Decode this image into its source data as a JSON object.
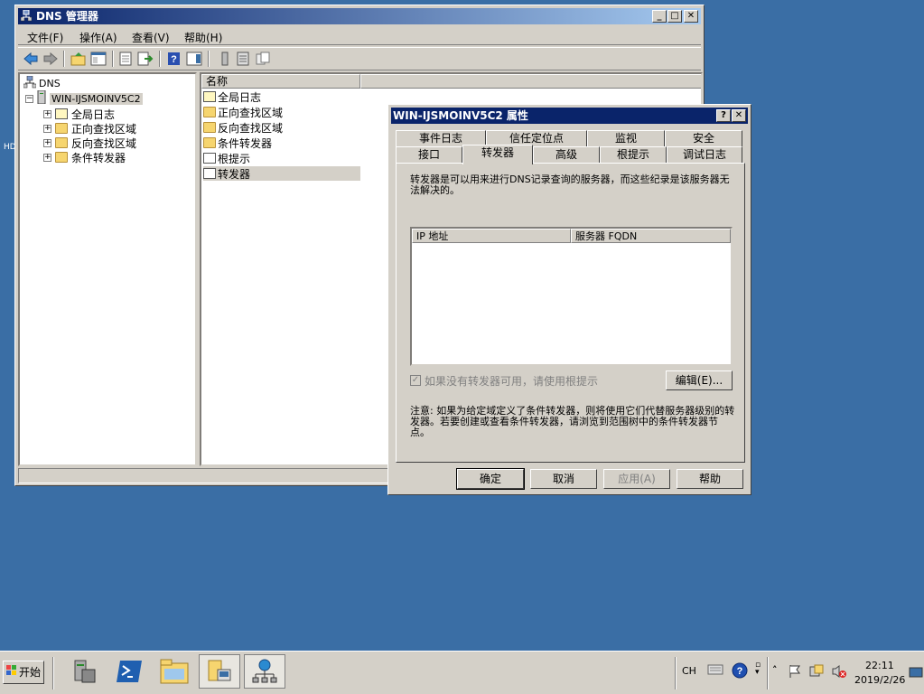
{
  "desktop": {
    "edge_label": "HD"
  },
  "main_window": {
    "title": "DNS 管理器",
    "menu": [
      "文件(F)",
      "操作(A)",
      "查看(V)",
      "帮助(H)"
    ],
    "tree": {
      "root": "DNS",
      "server": "WIN-IJSMOINV5C2",
      "children": [
        "全局日志",
        "正向查找区域",
        "反向查找区域",
        "条件转发器"
      ]
    },
    "list": {
      "column": "名称",
      "items": [
        "全局日志",
        "正向查找区域",
        "反向查找区域",
        "条件转发器",
        "根提示",
        "转发器"
      ]
    }
  },
  "dialog": {
    "title": "WIN-IJSMOINV5C2 属性",
    "tabs_row1": [
      "事件日志",
      "信任定位点",
      "监视",
      "安全"
    ],
    "tabs_row2": [
      "接口",
      "转发器",
      "高级",
      "根提示",
      "调试日志"
    ],
    "active_tab": "转发器",
    "description": "转发器是可以用来进行DNS记录查询的服务器，而这些纪录是该服务器无法解决的。",
    "table_headers": [
      "IP 地址",
      "服务器 FQDN"
    ],
    "checkbox_label": "如果没有转发器可用，请使用根提示",
    "edit_button": "编辑(E)...",
    "note": "注意: 如果为给定域定义了条件转发器，则将使用它们代替服务器级别的转发器。若要创建或查看条件转发器，请浏览到范围树中的条件转发器节点。",
    "buttons": {
      "ok": "确定",
      "cancel": "取消",
      "apply": "应用(A)",
      "help": "帮助"
    }
  },
  "taskbar": {
    "start": "开始",
    "lang": "CH",
    "time": "22:11",
    "date": "2019/2/26"
  }
}
